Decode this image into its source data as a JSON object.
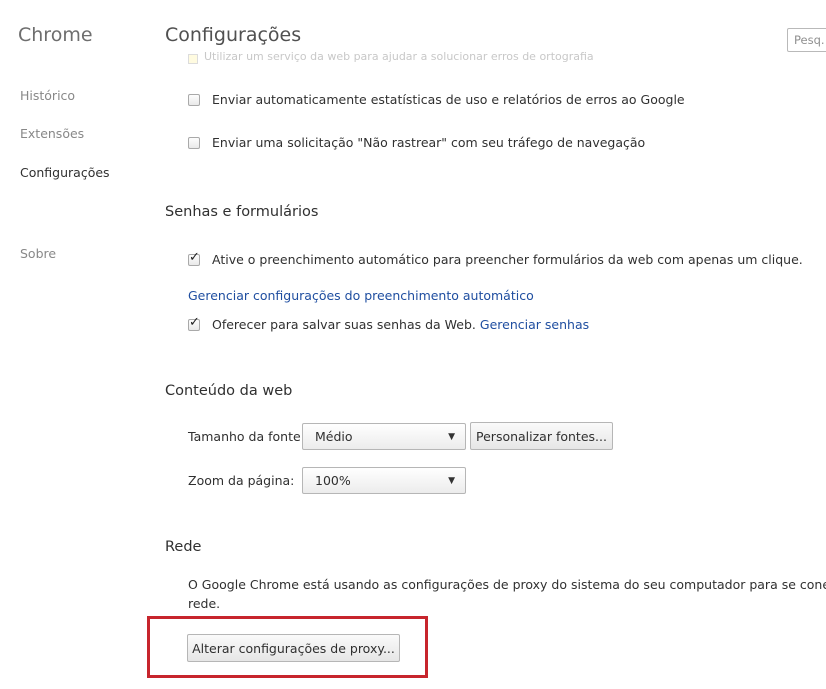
{
  "sidebar": {
    "brand": "Chrome",
    "items": [
      {
        "label": "Histórico"
      },
      {
        "label": "Extensões"
      },
      {
        "label": "Configurações"
      },
      {
        "label": "Sobre"
      }
    ]
  },
  "header": {
    "title": "Configurações",
    "search_text": "Pesq.",
    "faded_text": "Utilizar um serviço da web para ajudar a solucionar erros de ortografia"
  },
  "privacy": {
    "stats_label": "Enviar automaticamente estatísticas de uso e relatórios de erros ao Google",
    "dnt_label": "Enviar uma solicitação \"Não rastrear\" com seu tráfego de navegação"
  },
  "passwords": {
    "title": "Senhas e formulários",
    "autofill_label": "Ative o preenchimento automático para preencher formulários da web com apenas um clique.",
    "autofill_link": "Gerenciar configurações do preenchimento automático",
    "save_passwords_label": "Oferecer para salvar suas senhas da Web.",
    "manage_passwords_link": "Gerenciar senhas"
  },
  "web_content": {
    "title": "Conteúdo da web",
    "font_size_label": "Tamanho da fonte:",
    "font_size_value": "Médio",
    "customize_fonts_button": "Personalizar fontes...",
    "zoom_label": "Zoom da página:",
    "zoom_value": "100%"
  },
  "network": {
    "title": "Rede",
    "description_line1": "O Google Chrome está usando as configurações de proxy do sistema do seu computador para se conectar à",
    "description_line2": "rede.",
    "proxy_button": "Alterar configurações de proxy..."
  },
  "colors": {
    "highlight_border": "#c7252d",
    "link": "#1f4ea0"
  }
}
